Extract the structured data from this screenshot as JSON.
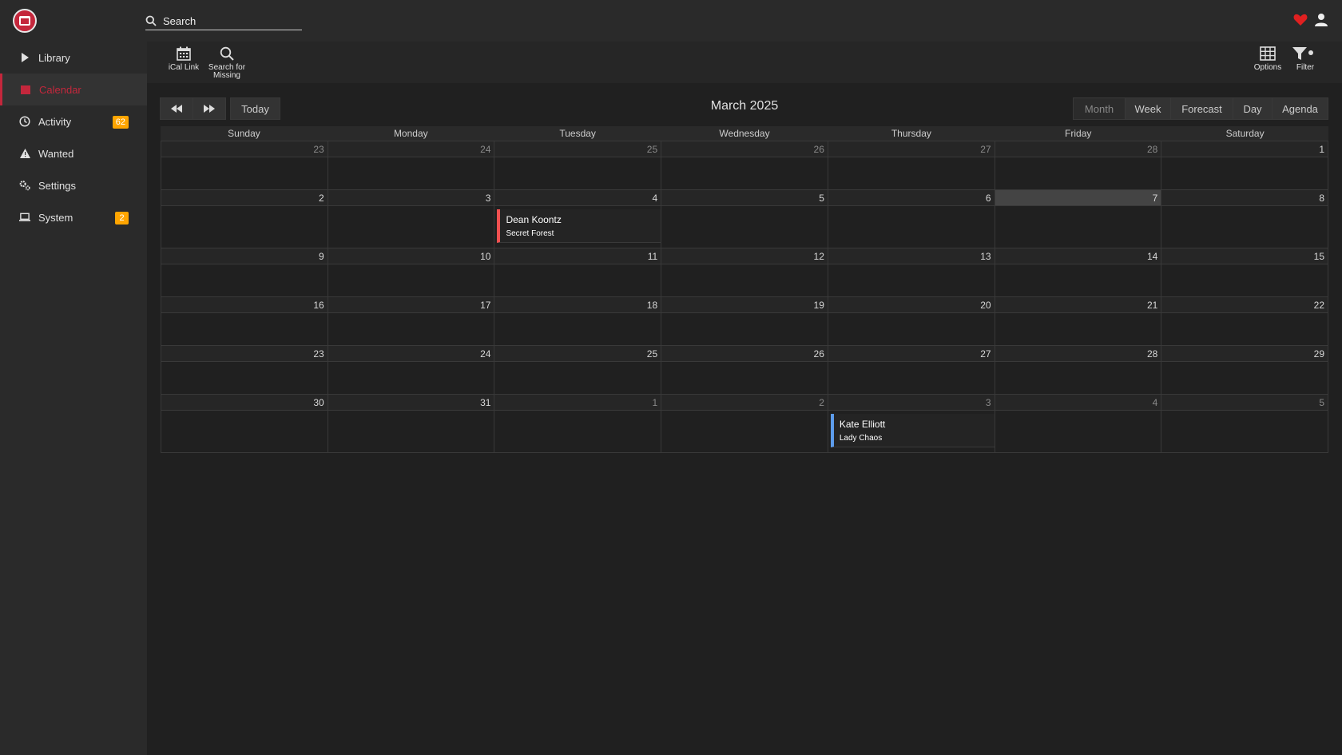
{
  "header": {
    "search_placeholder": "Search",
    "logo_icon": "logo-icon",
    "heart_icon": "heart-icon",
    "user_icon": "user-icon",
    "accent_color": "#c4273c"
  },
  "sidebar": {
    "items": [
      {
        "label": "Library",
        "icon": "play-icon"
      },
      {
        "label": "Calendar",
        "icon": "calendar-icon",
        "active": true
      },
      {
        "label": "Activity",
        "icon": "clock-icon",
        "badge": "62"
      },
      {
        "label": "Wanted",
        "icon": "warning-icon"
      },
      {
        "label": "Settings",
        "icon": "cogs-icon"
      },
      {
        "label": "System",
        "icon": "laptop-icon",
        "badge": "2"
      }
    ]
  },
  "toolbar": {
    "ical_label": "iCal Link",
    "search_missing_line1": "Search for",
    "search_missing_line2": "Missing",
    "options_label": "Options",
    "filter_label": "Filter"
  },
  "calendar": {
    "title": "March 2025",
    "today_label": "Today",
    "views": [
      "Month",
      "Week",
      "Forecast",
      "Day",
      "Agenda"
    ],
    "active_view": "Month",
    "weekdays": [
      "Sunday",
      "Monday",
      "Tuesday",
      "Wednesday",
      "Thursday",
      "Friday",
      "Saturday"
    ],
    "weeks": [
      {
        "days": [
          {
            "num": "23",
            "other": true
          },
          {
            "num": "24",
            "other": true
          },
          {
            "num": "25",
            "other": true
          },
          {
            "num": "26",
            "other": true
          },
          {
            "num": "27",
            "other": true
          },
          {
            "num": "28",
            "other": true
          },
          {
            "num": "1"
          }
        ]
      },
      {
        "days": [
          {
            "num": "2"
          },
          {
            "num": "3"
          },
          {
            "num": "4",
            "events": [
              {
                "author": "Dean Koontz",
                "title": "Secret Forest",
                "color": "red"
              }
            ]
          },
          {
            "num": "5"
          },
          {
            "num": "6"
          },
          {
            "num": "7",
            "today": true
          },
          {
            "num": "8"
          }
        ]
      },
      {
        "days": [
          {
            "num": "9"
          },
          {
            "num": "10"
          },
          {
            "num": "11"
          },
          {
            "num": "12"
          },
          {
            "num": "13"
          },
          {
            "num": "14"
          },
          {
            "num": "15"
          }
        ]
      },
      {
        "days": [
          {
            "num": "16"
          },
          {
            "num": "17"
          },
          {
            "num": "18"
          },
          {
            "num": "19"
          },
          {
            "num": "20"
          },
          {
            "num": "21"
          },
          {
            "num": "22"
          }
        ]
      },
      {
        "days": [
          {
            "num": "23"
          },
          {
            "num": "24"
          },
          {
            "num": "25"
          },
          {
            "num": "26"
          },
          {
            "num": "27"
          },
          {
            "num": "28"
          },
          {
            "num": "29"
          }
        ]
      },
      {
        "days": [
          {
            "num": "30"
          },
          {
            "num": "31"
          },
          {
            "num": "1",
            "other": true
          },
          {
            "num": "2",
            "other": true
          },
          {
            "num": "3",
            "other": true,
            "events": [
              {
                "author": "Kate Elliott",
                "title": "Lady Chaos",
                "color": "blue"
              }
            ]
          },
          {
            "num": "4",
            "other": true
          },
          {
            "num": "5",
            "other": true
          }
        ]
      }
    ]
  }
}
